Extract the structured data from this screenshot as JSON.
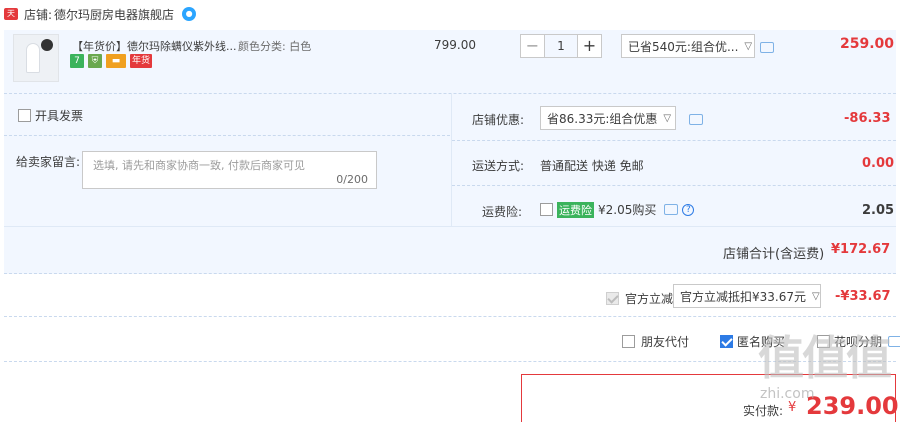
{
  "shop": {
    "label": "店铺:",
    "name": "德尔玛厨房电器旗舰店",
    "badge": "天猫"
  },
  "item": {
    "title": "【年货价】德尔玛除螨仪紫外线...",
    "sku": "颜色分类: 白色",
    "services": [
      "7",
      "年货"
    ],
    "unit_price": "799.00",
    "quantity": "1",
    "minus": "−",
    "plus": "+",
    "discount_select": "已省540元:组合优...",
    "subtotal": "259.00"
  },
  "invoice": {
    "label": "开具发票"
  },
  "message": {
    "label": "给卖家留言:",
    "placeholder": "选填, 请先和商家协商一致, 付款后商家可见",
    "counter": "0/200"
  },
  "shop_discount": {
    "label": "店铺优惠:",
    "select": "省86.33元:组合优惠",
    "amount": "-86.33"
  },
  "shipping": {
    "label": "运送方式:",
    "value": "普通配送 快递 免邮",
    "amount": "0.00"
  },
  "insurance": {
    "label": "运费险:",
    "tag": "运费险",
    "price": "¥2.05购买",
    "amount": "2.05"
  },
  "shop_total": {
    "label": "店铺合计(含运费)",
    "amount": "¥172.67"
  },
  "official": {
    "label": "官方立减",
    "select": "官方立减抵扣¥33.67元",
    "amount": "-¥33.67"
  },
  "options": {
    "friend_pay": "朋友代付",
    "anonymous": "匿名购买",
    "huabei": "花呗分期"
  },
  "pay": {
    "label": "实付款:",
    "currency": "¥",
    "amount": "239.00"
  },
  "watermark": {
    "text": "值值值",
    "sub": "zhi.com"
  }
}
